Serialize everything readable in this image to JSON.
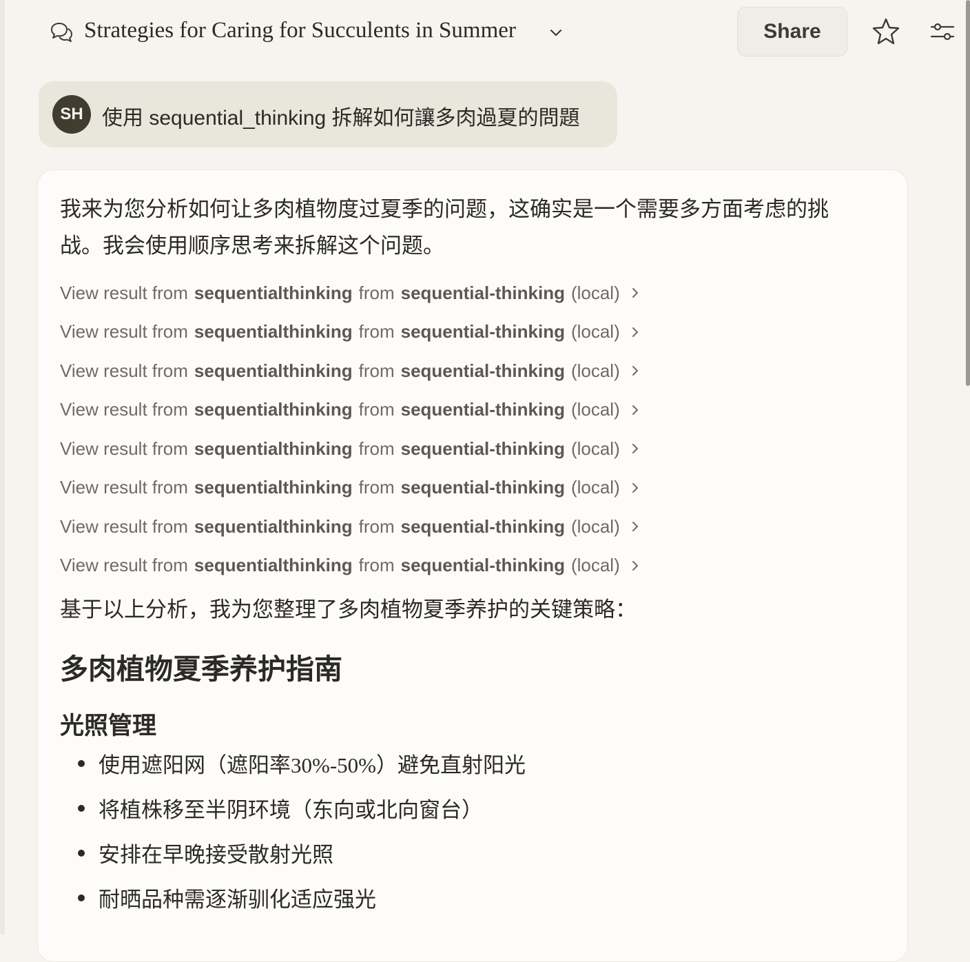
{
  "header": {
    "title": "Strategies for Caring for Succulents in Summer",
    "share_label": "Share"
  },
  "user_message": {
    "avatar_initials": "SH",
    "text": "使用 sequential_thinking 拆解如何讓多肉過夏的問題"
  },
  "response": {
    "intro": "我来为您分析如何让多肉植物度过夏季的问题，这确实是一个需要多方面考虑的挑战。我会使用顺序思考来拆解这个问题。",
    "tool_results": [
      {
        "prefix": "View result from",
        "tool": "sequentialthinking",
        "mid": "from",
        "server": "sequential-thinking",
        "suffix": "(local)"
      },
      {
        "prefix": "View result from",
        "tool": "sequentialthinking",
        "mid": "from",
        "server": "sequential-thinking",
        "suffix": "(local)"
      },
      {
        "prefix": "View result from",
        "tool": "sequentialthinking",
        "mid": "from",
        "server": "sequential-thinking",
        "suffix": "(local)"
      },
      {
        "prefix": "View result from",
        "tool": "sequentialthinking",
        "mid": "from",
        "server": "sequential-thinking",
        "suffix": "(local)"
      },
      {
        "prefix": "View result from",
        "tool": "sequentialthinking",
        "mid": "from",
        "server": "sequential-thinking",
        "suffix": "(local)"
      },
      {
        "prefix": "View result from",
        "tool": "sequentialthinking",
        "mid": "from",
        "server": "sequential-thinking",
        "suffix": "(local)"
      },
      {
        "prefix": "View result from",
        "tool": "sequentialthinking",
        "mid": "from",
        "server": "sequential-thinking",
        "suffix": "(local)"
      },
      {
        "prefix": "View result from",
        "tool": "sequentialthinking",
        "mid": "from",
        "server": "sequential-thinking",
        "suffix": "(local)"
      }
    ],
    "summary": "基于以上分析，我为您整理了多肉植物夏季养护的关键策略：",
    "guide_heading": "多肉植物夏季养护指南",
    "section_heading": "光照管理",
    "bullets": [
      "使用遮阳网（遮阳率30%-50%）避免直射阳光",
      "将植株移至半阴环境（东向或北向窗台）",
      "安排在早晚接受散射光照",
      "耐晒品种需逐渐驯化适应强光"
    ]
  },
  "icons": {
    "chat": "chat-bubbles-icon",
    "title_dropdown": "chevron-down-icon",
    "star": "star-icon",
    "settings": "sliders-icon",
    "tool_row": "chevron-right-icon"
  },
  "colors": {
    "page_bg": "#f5f4ef",
    "card_bg": "#fdfcfa",
    "user_bubble": "#e9e6dc",
    "avatar_bg": "#403c30",
    "text": "#2b2a26",
    "muted_text": "#6d6b63"
  }
}
